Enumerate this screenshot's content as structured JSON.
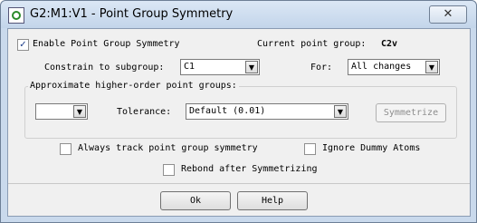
{
  "window": {
    "title": "G2:M1:V1 - Point Group Symmetry",
    "close_glyph": "✕"
  },
  "enable": {
    "label": "Enable Point Group Symmetry",
    "checked": true,
    "check_glyph": "✓"
  },
  "current_point_group": {
    "label": "Current point group:",
    "value": "C2v"
  },
  "constrain": {
    "label": "Constrain to subgroup:",
    "value": "C1"
  },
  "for_field": {
    "label": "For:",
    "value": "All changes"
  },
  "approx_group": {
    "title": "Approximate higher-order point groups:",
    "group_value": "",
    "tolerance_label": "Tolerance:",
    "tolerance_value": "Default (0.01)",
    "symmetrize_label": "Symmetrize"
  },
  "options": {
    "always_track": {
      "label": "Always track point group symmetry",
      "checked": false
    },
    "ignore_dummy": {
      "label": "Ignore Dummy Atoms",
      "checked": false
    },
    "rebond": {
      "label": "Rebond after Symmetrizing",
      "checked": false
    }
  },
  "buttons": {
    "ok": "Ok",
    "help": "Help"
  },
  "dropdown_glyph": "▼",
  "colors": {
    "title_bar": "#c9d9ec",
    "dialog_bg": "#f0f0f0",
    "disabled_text": "#8d8d8d"
  }
}
